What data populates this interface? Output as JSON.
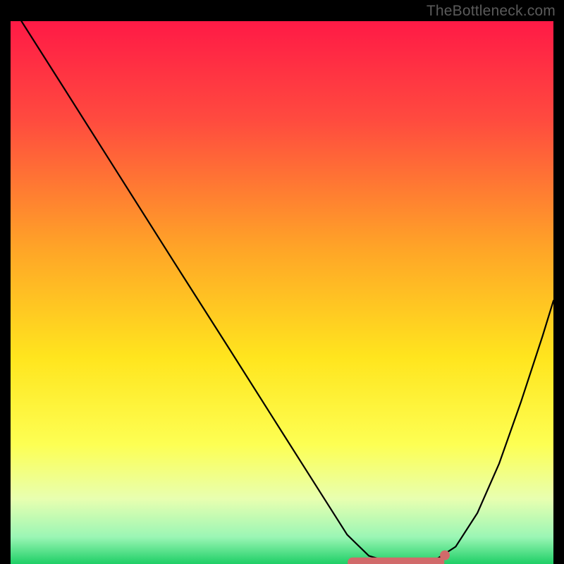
{
  "watermark": "TheBottleneck.com",
  "chart_data": {
    "type": "line",
    "title": "",
    "xlabel": "",
    "ylabel": "",
    "xlim": [
      0,
      100
    ],
    "ylim": [
      0,
      100
    ],
    "series": [
      {
        "name": "curve",
        "x": [
          2,
          10,
          20,
          30,
          40,
          50,
          58,
          62,
          66,
          70,
          74,
          78,
          82,
          86,
          90,
          94,
          98,
          100
        ],
        "values": [
          100,
          87.4,
          71.6,
          55.8,
          40.1,
          24.3,
          11.7,
          5.4,
          1.5,
          0.3,
          0.1,
          0.6,
          3.2,
          9.4,
          18.5,
          29.8,
          42.0,
          48.5
        ]
      }
    ],
    "highlight_band": {
      "x_start": 63,
      "x_end": 79,
      "y": 0.3
    },
    "highlight_dot": {
      "x": 80,
      "y": 1.6
    },
    "gradient_stops": [
      {
        "offset": 0.0,
        "color": "#ff1a46"
      },
      {
        "offset": 0.18,
        "color": "#ff4a3f"
      },
      {
        "offset": 0.42,
        "color": "#ffa527"
      },
      {
        "offset": 0.62,
        "color": "#ffe51e"
      },
      {
        "offset": 0.78,
        "color": "#fdff53"
      },
      {
        "offset": 0.88,
        "color": "#e8ffb0"
      },
      {
        "offset": 0.95,
        "color": "#9bf6b5"
      },
      {
        "offset": 1.0,
        "color": "#1ecf66"
      }
    ]
  }
}
